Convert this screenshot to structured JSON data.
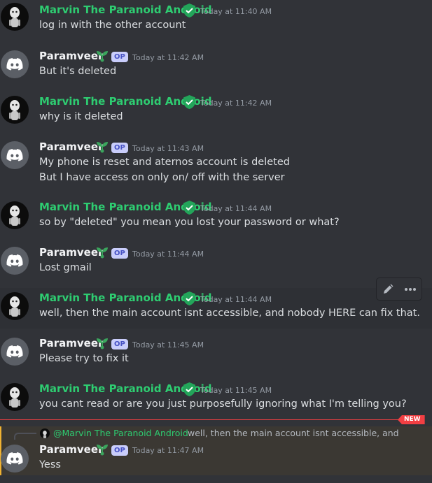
{
  "messages": [
    {
      "author": "Marvin The Paranoid Android",
      "type": "marvin",
      "time": "Today at 11:40 AM",
      "lines": [
        "log in with the other account"
      ]
    },
    {
      "author": "Paramveer",
      "type": "param",
      "op": "OP",
      "time": "Today at 11:42 AM",
      "lines": [
        "But it's deleted"
      ]
    },
    {
      "author": "Marvin The Paranoid Android",
      "type": "marvin",
      "time": "Today at 11:42 AM",
      "lines": [
        "why is it deleted"
      ]
    },
    {
      "author": "Paramveer",
      "type": "param",
      "op": "OP",
      "time": "Today at 11:43 AM",
      "lines": [
        "My phone is reset and aternos account is deleted",
        "But I have access on only on/ off with the server"
      ]
    },
    {
      "author": "Marvin The Paranoid Android",
      "type": "marvin",
      "time": "Today at 11:44 AM",
      "lines": [
        "so by \"deleted\" you mean you lost your password or what?"
      ]
    },
    {
      "author": "Paramveer",
      "type": "param",
      "op": "OP",
      "time": "Today at 11:44 AM",
      "lines": [
        "Lost gmail"
      ]
    },
    {
      "author": "Marvin The Paranoid Android",
      "type": "marvin",
      "time": "Today at 11:44 AM",
      "lines": [
        "well, then the main account isnt accessible, and nobody HERE can fix that."
      ]
    },
    {
      "author": "Paramveer",
      "type": "param",
      "op": "OP",
      "time": "Today at 11:45 AM",
      "lines": [
        "Please try to fix it"
      ]
    },
    {
      "author": "Marvin The Paranoid Android",
      "type": "marvin",
      "time": "Today at 11:45 AM",
      "lines": [
        "you cant read or are you just purposefully ignoring what I'm telling you?"
      ]
    }
  ],
  "new_label": "NEW",
  "reply": {
    "mention": "@Marvin The Paranoid Android",
    "snippet": "well, then the main account isnt accessible, and nobody HERE can fix that.",
    "author": "Paramveer",
    "op": "OP",
    "time": "Today at 11:47 AM",
    "text": "Yess"
  },
  "icons": {
    "edit": "pencil-icon",
    "more": "more-options-icon",
    "verified": "shield-check-icon",
    "sprout": "sprout-icon",
    "avatar": "discord-logo-icon"
  },
  "colors": {
    "marvin_name": "#2ecc71",
    "background": "#313338",
    "new_divider": "#f23f43",
    "mention_bg": "#3b3833",
    "op_badge": "#c9cdfb"
  }
}
